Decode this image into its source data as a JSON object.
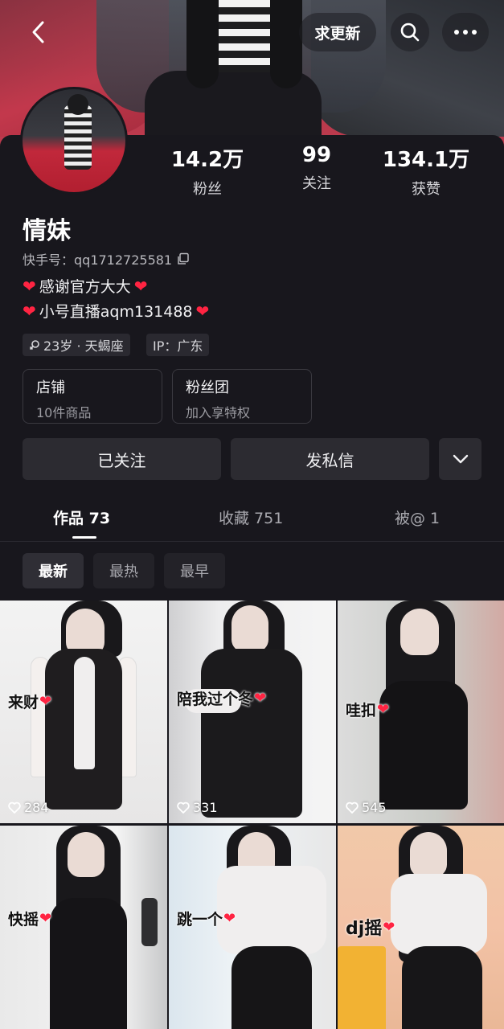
{
  "header": {
    "request_update_label": "求更新",
    "back_icon": "chevron-left-icon",
    "search_icon": "search-icon",
    "more_icon": "more-dots-icon"
  },
  "profile": {
    "name": "情妹",
    "kuaishou_id_label": "快手号：qq1712725581",
    "bio_lines": [
      "感谢官方大大",
      "小号直播aqm131488"
    ],
    "stats": [
      {
        "value": "14.2万",
        "label": "粉丝"
      },
      {
        "value": "99",
        "label": "关注"
      },
      {
        "value": "134.1万",
        "label": "获赞"
      }
    ],
    "tags": [
      "23岁 · 天蝎座",
      "IP：广东"
    ],
    "cards": [
      {
        "title": "店铺",
        "subtitle": "10件商品"
      },
      {
        "title": "粉丝团",
        "subtitle": "加入享特权"
      }
    ],
    "actions": {
      "followed_label": "已关注",
      "message_label": "发私信"
    }
  },
  "tabs": [
    {
      "label": "作品 73",
      "active": true
    },
    {
      "label": "收藏 751",
      "active": false
    },
    {
      "label": "被@ 1",
      "active": false
    }
  ],
  "filters": [
    {
      "label": "最新",
      "active": true
    },
    {
      "label": "最热",
      "active": false
    },
    {
      "label": "最早",
      "active": false
    }
  ],
  "videos": [
    {
      "caption": "来财",
      "likes": "284"
    },
    {
      "caption": "陪我过个冬",
      "likes": "331"
    },
    {
      "caption": "哇扣",
      "likes": "545"
    },
    {
      "caption": "快摇",
      "likes": ""
    },
    {
      "caption": "跳一个",
      "likes": ""
    },
    {
      "caption": "dj摇",
      "likes": ""
    }
  ],
  "colors": {
    "background": "#18171d",
    "heart": "#ff2442",
    "button": "#2c2b31"
  }
}
